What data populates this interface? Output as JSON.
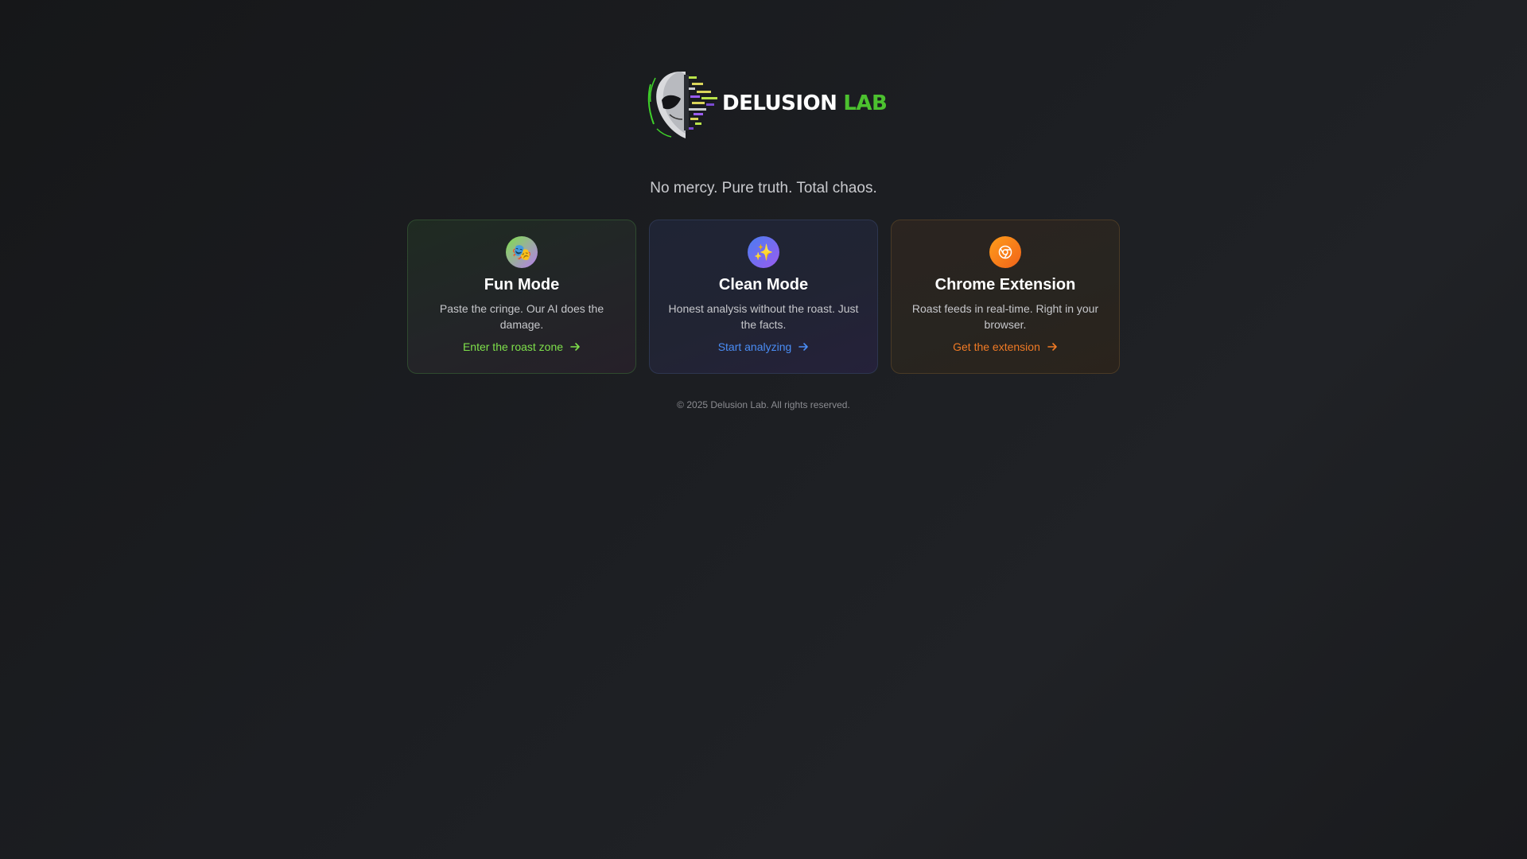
{
  "brand": {
    "name_part1": "DELUSION",
    "name_part2": "LAB",
    "logo_icon": "alien-glitch-logo-icon",
    "accent_color": "#4cc12f"
  },
  "tagline": "No mercy. Pure truth. Total chaos.",
  "cards": [
    {
      "title": "Fun Mode",
      "description": "Paste the cringe. Our AI does the damage.",
      "link_label": "Enter the roast zone",
      "icon": "theater-masks-icon",
      "icon_glyph": "🎭",
      "accent_color": "#7ee04a"
    },
    {
      "title": "Clean Mode",
      "description": "Honest analysis without the roast. Just the facts.",
      "link_label": "Start analyzing",
      "icon": "sparkles-icon",
      "icon_glyph": "✨",
      "accent_color": "#4a8df5"
    },
    {
      "title": "Chrome Extension",
      "description": "Roast feeds in real-time. Right in your browser.",
      "link_label": "Get the extension",
      "icon": "chrome-icon",
      "accent_color": "#f07a25"
    }
  ],
  "footer": "© 2025 Delusion Lab. All rights reserved."
}
